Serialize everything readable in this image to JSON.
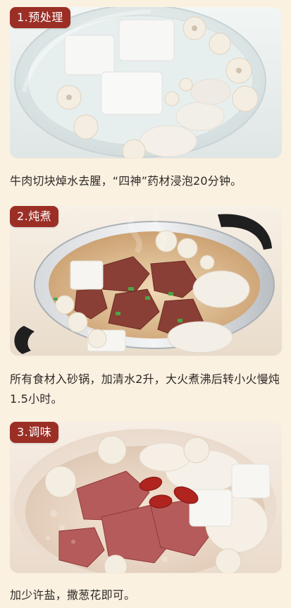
{
  "steps": [
    {
      "badge": "1.预处理",
      "caption": "牛肉切块焯水去腥，“四神”药材浸泡20分钟。"
    },
    {
      "badge": "2.炖煮",
      "caption": "所有食材入砂锅，加清水2升，大火煮沸后转小火慢炖1.5小时。"
    },
    {
      "badge": "3.调味",
      "caption": "加少许盐，撒葱花即可。"
    }
  ],
  "colors": {
    "page_bg": "#fbf1e1",
    "badge_bg": "#9b2f26",
    "badge_text": "#ffffff",
    "caption_text": "#2d2a27"
  }
}
